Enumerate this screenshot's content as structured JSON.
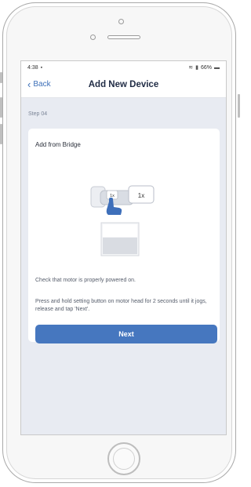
{
  "status_bar": {
    "time": "4:38",
    "battery": "66%"
  },
  "nav": {
    "back_label": "Back",
    "title": "Add New Device"
  },
  "step_label": "Step 04",
  "card": {
    "title": "Add from Bridge",
    "illustration": {
      "small_badge": "1x",
      "large_badge": "1x"
    },
    "instruction_1": "Check that motor is properly powered on.",
    "instruction_2": "Press and hold setting button on motor head for 2 seconds until it jogs, release and tap 'Next'.",
    "next_label": "Next"
  },
  "colors": {
    "accent": "#4677bf",
    "screen_bg": "#e8ebf2",
    "title_text": "#1f2b44"
  }
}
